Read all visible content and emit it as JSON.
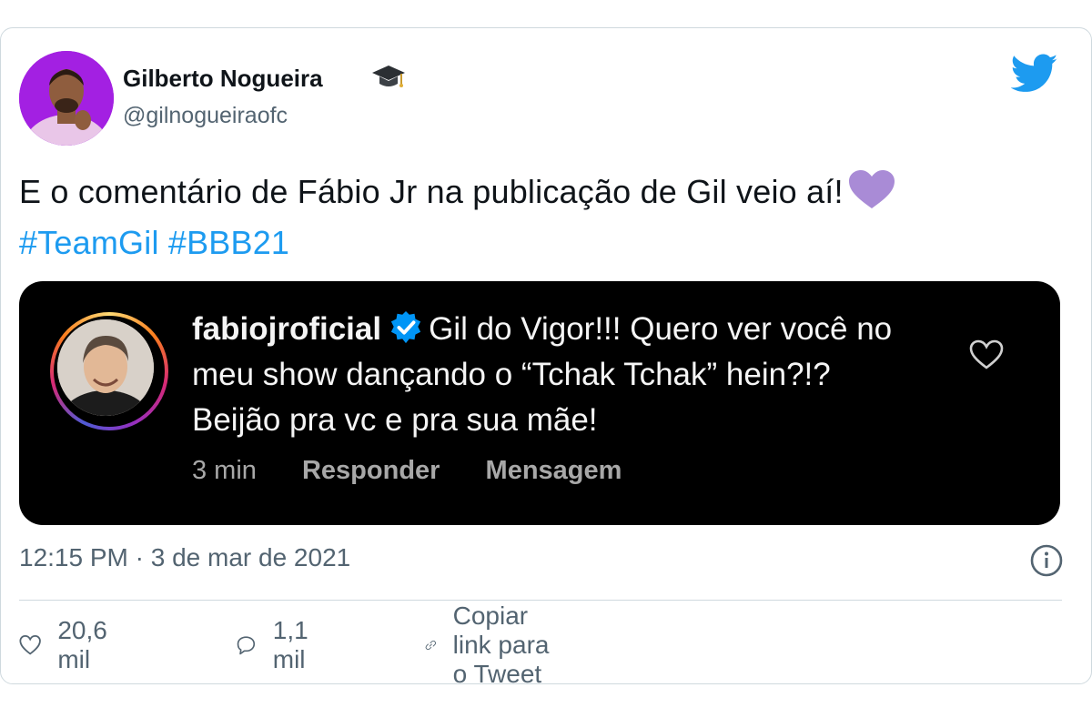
{
  "tweet": {
    "author_name": "Gilberto Nogueira",
    "author_handle": "@gilnogueiraofc",
    "text_main": "E o comentário de Fábio Jr na publicação de Gil veio aí!",
    "hashtags": "#TeamGil #BBB21",
    "timestamp": "12:15 PM · 3 de mar de 2021",
    "likes": "20,6 mil",
    "replies": "1,1 mil",
    "copy_link_label": "Copiar link para o Tweet"
  },
  "embed": {
    "username": "fabiojroficial",
    "comment": "Gil do Vigor!!! Quero ver você no meu show dançando o “Tchak Tchak” hein?!? Beijão pra vc e pra sua mãe!",
    "time": "3 min",
    "reply_label": "Responder",
    "message_label": "Mensagem"
  },
  "icons": {
    "author_badge": "graduation-cap-icon",
    "brand": "twitter-bird-icon",
    "emoji": "purple-heart-icon",
    "verified": "verified-badge-icon",
    "embed_like": "heart-outline-icon",
    "info": "info-icon",
    "like": "heart-outline-icon",
    "reply": "speech-bubble-icon",
    "copy_link": "link-icon"
  },
  "colors": {
    "twitter_blue": "#1d9bf0",
    "hashtag": "#1d9bf0",
    "purple_heart": "#a98bd6",
    "embed_background": "#000000",
    "secondary_text": "#536471"
  }
}
